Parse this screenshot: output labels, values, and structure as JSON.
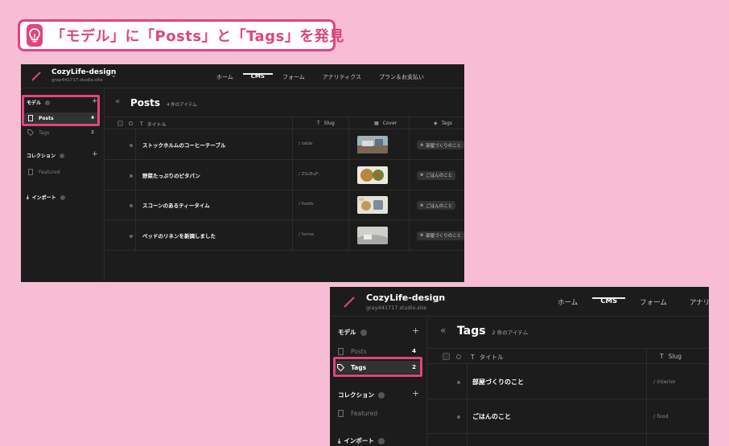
{
  "banner": {
    "text": "「モデル」に「Posts」と「Tags」を発見",
    "icon": "lightbulb-icon",
    "accent": "#e0457b"
  },
  "panel1": {
    "project_name": "CozyLife-design",
    "project_url": "gray441717.studio.site",
    "nav": [
      "ホーム",
      "CMS",
      "フォーム",
      "アナリティクス",
      "プラン＆お支払い"
    ],
    "active_nav": "CMS",
    "sidebar": {
      "models_label": "モデル",
      "collections_label": "コレクション",
      "import_label": "インポート",
      "models": [
        {
          "label": "Posts",
          "count": "4"
        },
        {
          "label": "Tags",
          "count": "2"
        }
      ],
      "collections": [
        {
          "label": "Featured"
        }
      ]
    },
    "header": {
      "title": "Posts",
      "count": "4 件のアイテム"
    },
    "columns": {
      "title": "タイトル",
      "slug": "Slug",
      "cover": "Cover",
      "tags": "Tags"
    },
    "rows": [
      {
        "title": "ストックホルムのコーヒーテーブル",
        "slug": "/ table",
        "tag": "部屋づくりのこと"
      },
      {
        "title": "野菜たっぷりのピタパン",
        "slug": "/ ZScBuF-",
        "tag": "ごはんのこと"
      },
      {
        "title": "スコーンのあるティータイム",
        "slug": "/ foods",
        "tag": "ごはんのこと"
      },
      {
        "title": "ベッドのリネンを新調しました",
        "slug": "/ home",
        "tag": "部屋づくりのこと"
      }
    ]
  },
  "panel2": {
    "project_name": "CozyLife-design",
    "project_url": "gray441717.studio.site",
    "nav": [
      "ホーム",
      "CMS",
      "フォーム",
      "アナリティ"
    ],
    "active_nav": "CMS",
    "sidebar": {
      "models_label": "モデル",
      "collections_label": "コレクション",
      "import_label": "インポート",
      "models": [
        {
          "label": "Posts",
          "count": "4"
        },
        {
          "label": "Tags",
          "count": "2"
        }
      ],
      "collections": [
        {
          "label": "Featured"
        }
      ]
    },
    "header": {
      "title": "Tags",
      "count": "2 件のアイテム"
    },
    "columns": {
      "title": "タイトル",
      "slug": "Slug"
    },
    "rows": [
      {
        "title": "部屋づくりのこと",
        "slug": "/ interior"
      },
      {
        "title": "ごはんのこと",
        "slug": "/ food"
      }
    ]
  }
}
